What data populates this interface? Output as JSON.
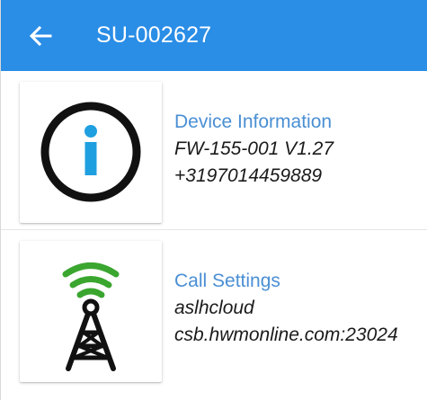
{
  "app_bar": {
    "title": "SU-002627",
    "back_icon": "arrow-left-icon",
    "background": "#2a8de6"
  },
  "items": [
    {
      "title": "Device Information",
      "line1": "FW-155-001 V1.27",
      "line2": "+3197014459889",
      "icon": "info-circle-icon"
    },
    {
      "title": "Call Settings",
      "line1": "aslhcloud",
      "line2": "csb.hwmonline.com:23024",
      "icon": "radio-tower-icon"
    }
  ],
  "colors": {
    "title_text": "#4a8fd4",
    "info_accent": "#1e9fe0",
    "signal_green": "#3aa62f"
  }
}
